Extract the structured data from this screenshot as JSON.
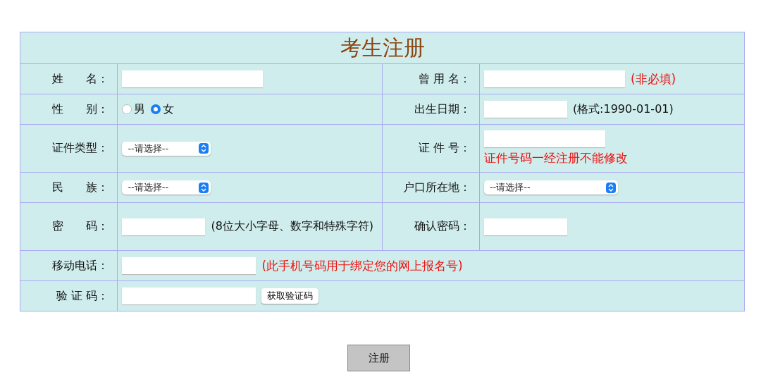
{
  "title": "考生注册",
  "rows": [
    {
      "fields": [
        {
          "label": "姓　　名：",
          "controls": [
            {
              "kind": "input"
            }
          ]
        },
        {
          "label": "曾 用 名：",
          "controls": [
            {
              "kind": "input"
            },
            {
              "kind": "warning",
              "text": "(非必填)"
            }
          ]
        }
      ]
    },
    {
      "fields": [
        {
          "label": "性　　别：",
          "controls": [
            {
              "kind": "radio",
              "label": "男",
              "selected": false
            },
            {
              "kind": "radio",
              "label": "女",
              "selected": true
            }
          ]
        },
        {
          "label": "出生日期：",
          "controls": [
            {
              "kind": "input"
            },
            {
              "kind": "note",
              "text": "(格式:1990-01-01)"
            }
          ]
        }
      ]
    },
    {
      "fields": [
        {
          "label": "证件类型：",
          "controls": [
            {
              "kind": "select",
              "value": "--请选择--"
            }
          ]
        },
        {
          "label": "证 件 号：",
          "controls": [
            {
              "kind": "input"
            },
            {
              "kind": "warning",
              "text": "证件号码一经注册不能修改"
            }
          ]
        }
      ]
    },
    {
      "fields": [
        {
          "label": "民　　族：",
          "controls": [
            {
              "kind": "select",
              "value": "--请选择--"
            }
          ]
        },
        {
          "label": "户口所在地：",
          "controls": [
            {
              "kind": "select",
              "value": "--请选择--"
            }
          ]
        }
      ]
    },
    {
      "fields": [
        {
          "label": "密　　码：",
          "controls": [
            {
              "kind": "input"
            },
            {
              "kind": "note",
              "text": "(8位大小字母、数字和特殊字符)"
            }
          ]
        },
        {
          "label": "确认密码：",
          "controls": [
            {
              "kind": "input"
            }
          ]
        }
      ]
    },
    {
      "fields": [
        {
          "label": "移动电话：",
          "controls": [
            {
              "kind": "input"
            },
            {
              "kind": "warning",
              "text": "(此手机号码用于绑定您的网上报名号)"
            }
          ]
        }
      ]
    },
    {
      "fields": [
        {
          "label": "验 证 码：",
          "controls": [
            {
              "kind": "input"
            },
            {
              "kind": "button",
              "label": "获取验证码"
            }
          ]
        }
      ]
    }
  ],
  "submit": "注册"
}
